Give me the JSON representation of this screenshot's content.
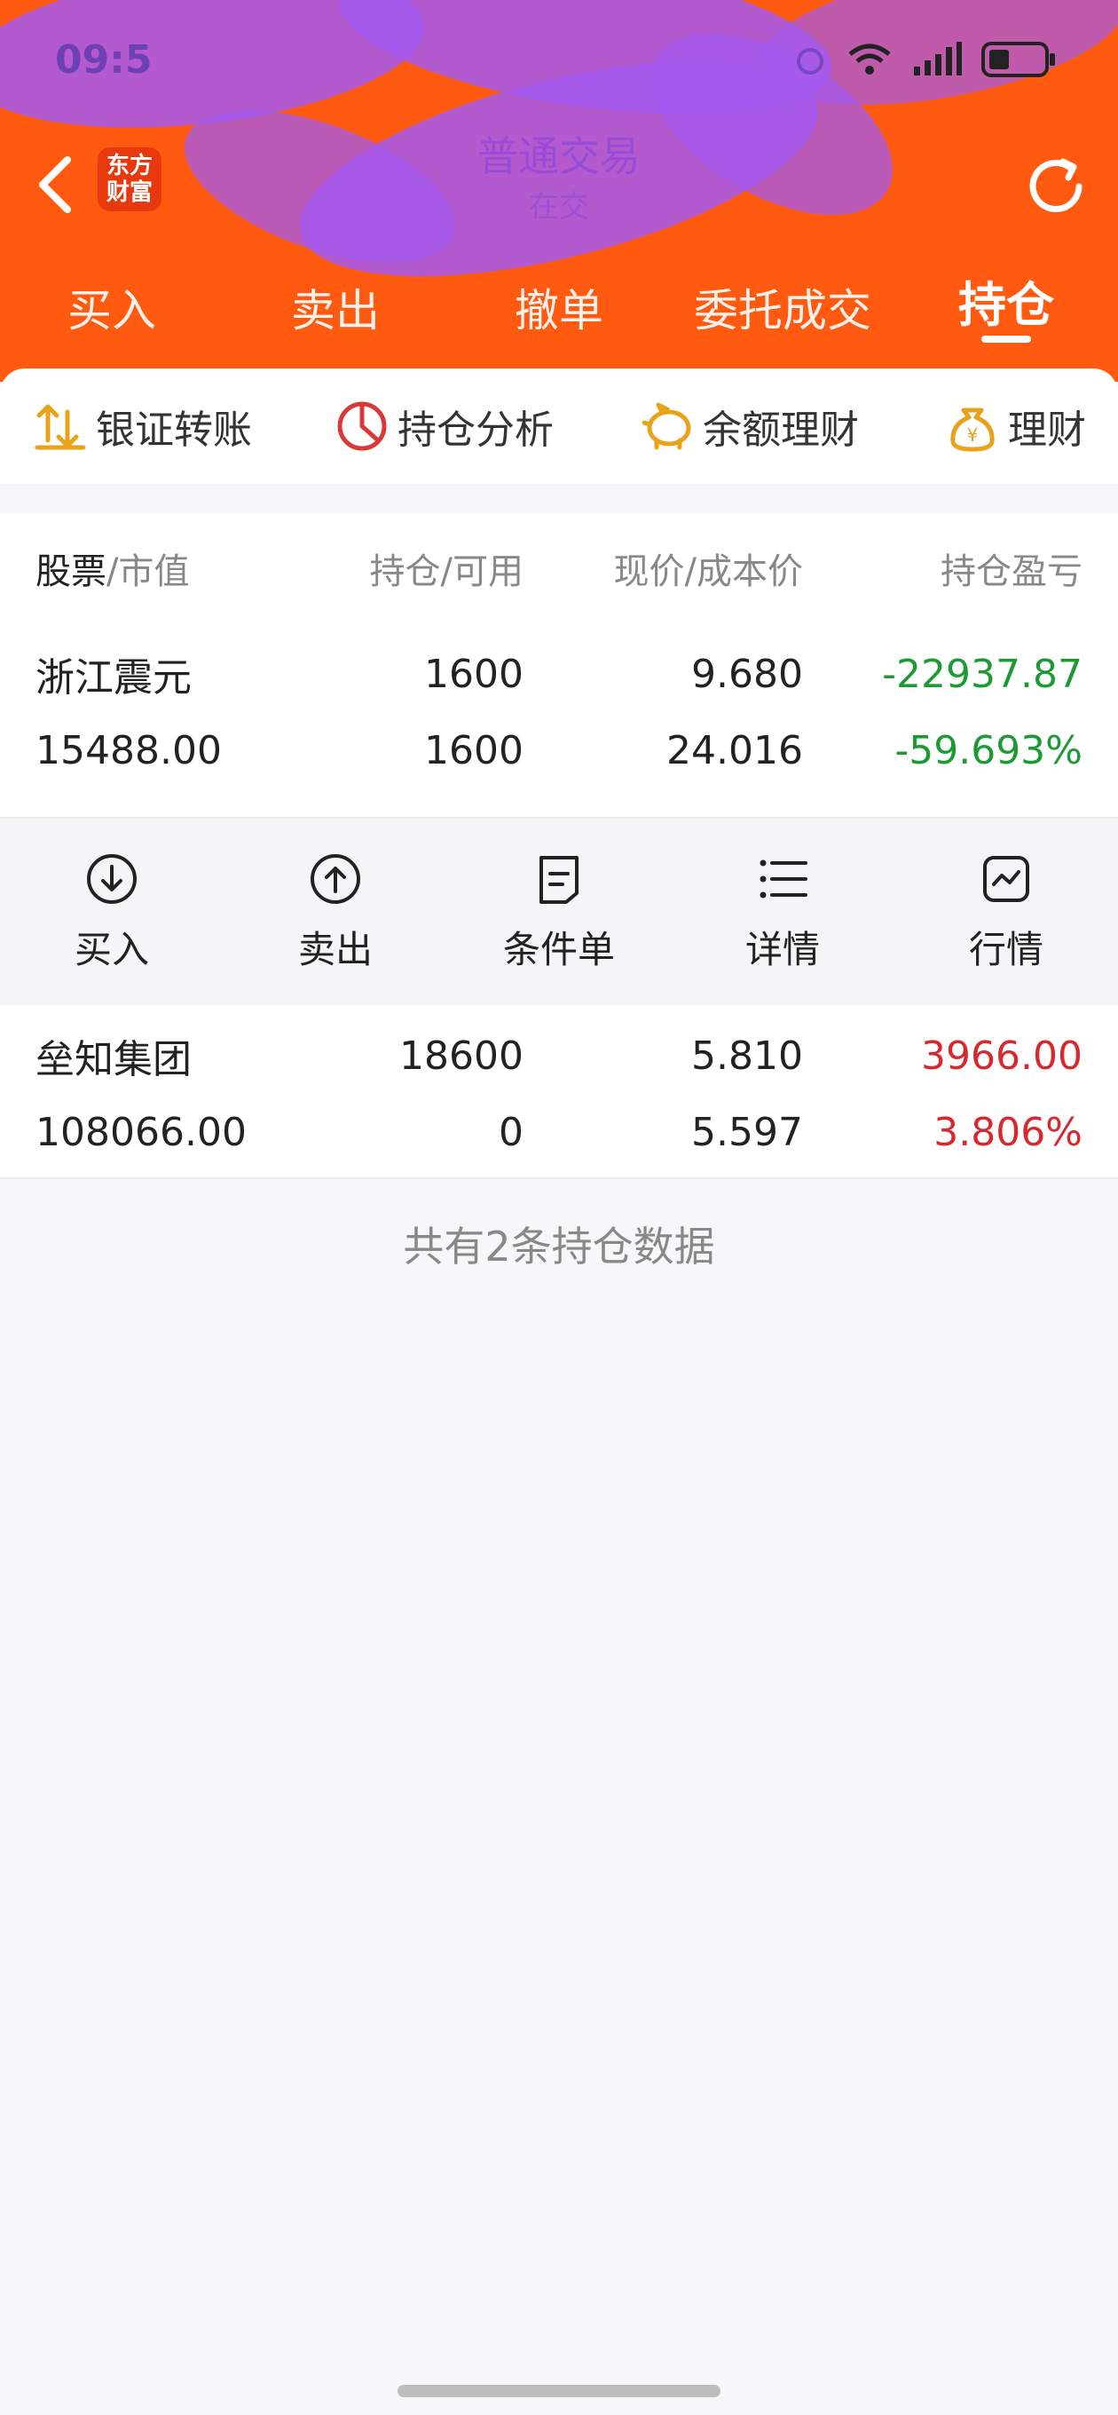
{
  "status_bar": {
    "time": "09:5"
  },
  "header": {
    "brand_logo": "东方\n财富",
    "title": "普通交易",
    "subtitle": "在交",
    "back_icon": "chevron-left-icon",
    "refresh_icon": "refresh-icon",
    "background": "#ff5a0f"
  },
  "tabs": [
    {
      "label": "买入",
      "active": false
    },
    {
      "label": "卖出",
      "active": false
    },
    {
      "label": "撤单",
      "active": false
    },
    {
      "label": "委托成交",
      "active": false
    },
    {
      "label": "持仓",
      "active": true
    }
  ],
  "tools": [
    {
      "label": "银证转账",
      "icon": "transfer-icon"
    },
    {
      "label": "持仓分析",
      "icon": "pie-chart-icon"
    },
    {
      "label": "余额理财",
      "icon": "piggy-bank-icon"
    },
    {
      "label": "理财",
      "icon": "money-bag-icon"
    }
  ],
  "table": {
    "headers": {
      "name": "股票",
      "market_value": "/市值",
      "position": "持仓/可用",
      "price": "现价/成本价",
      "pnl": "持仓盈亏"
    },
    "rows": [
      {
        "name": "浙江震元",
        "market_value": "15488.00",
        "position": "1600",
        "available": "1600",
        "price": "9.680",
        "cost": "24.016",
        "pnl": "-22937.87",
        "pnl_pct": "-59.693%",
        "color": "#1e9a34"
      },
      {
        "name": "垒知集团",
        "market_value": "108066.00",
        "position": "18600",
        "available": "0",
        "price": "5.810",
        "cost": "5.597",
        "pnl": "3966.00",
        "pnl_pct": "3.806%",
        "color": "#d6282e"
      }
    ]
  },
  "row_actions": [
    {
      "label": "买入",
      "icon": "arrow-down-circle-icon"
    },
    {
      "label": "卖出",
      "icon": "arrow-up-circle-icon"
    },
    {
      "label": "条件单",
      "icon": "document-icon"
    },
    {
      "label": "详情",
      "icon": "list-icon"
    },
    {
      "label": "行情",
      "icon": "trend-chart-icon"
    }
  ],
  "footer_note": "共有2条持仓数据"
}
